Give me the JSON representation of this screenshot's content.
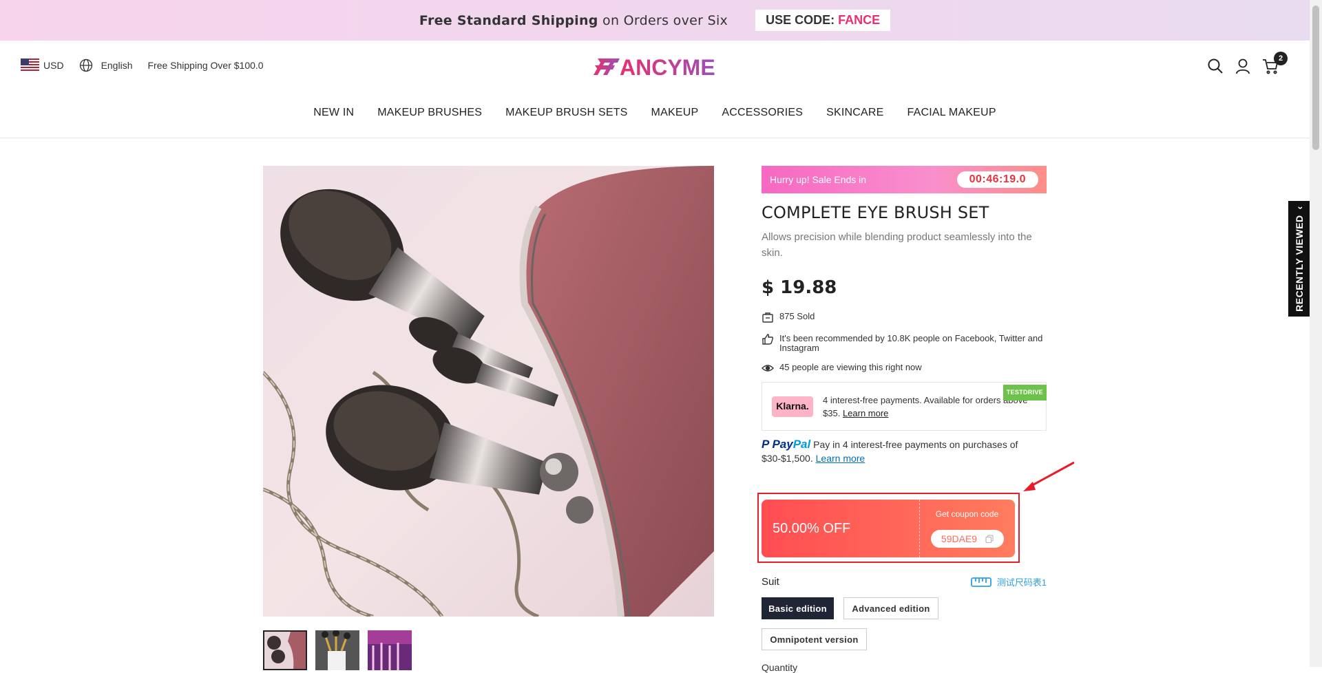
{
  "announcement": {
    "bold": "Free Standard Shipping",
    "rest": " on Orders over Six",
    "code_label": "USE CODE: ",
    "code": "FANCE"
  },
  "header": {
    "currency": "USD",
    "language": "English",
    "shipping_note": "Free Shipping Over $100.0",
    "logo_text": "ANCYME",
    "cart_count": "2"
  },
  "nav": [
    "NEW IN",
    "MAKEUP BRUSHES",
    "MAKEUP BRUSH SETS",
    "MAKEUP",
    "ACCESSORIES",
    "SKINCARE",
    "FACIAL MAKEUP"
  ],
  "recently_viewed": "RECENTLY VIEWED",
  "product": {
    "sale_label": "Hurry up! Sale Ends in",
    "timer": "00:46:19.0",
    "title": "COMPLETE EYE BRUSH SET",
    "description": "Allows precision while blending product seamlessly into the skin.",
    "price": "$ 19.88",
    "sold": "875 Sold",
    "recommended": "It's been recommended by 10.8K people on Facebook, Twitter and Instagram",
    "viewing": "45 people are viewing this right now"
  },
  "klarna": {
    "logo": "Klarna.",
    "text": "4 interest-free payments. Available for orders above $35.",
    "link": "Learn more",
    "tag": "TESTDRIVE"
  },
  "paypal": {
    "logo_a": "Pay",
    "logo_b": "Pal",
    "text": "Pay in 4 interest-free payments on purchases of $30-$1,500.",
    "link": "Learn more"
  },
  "coupon": {
    "discount": "50.00% OFF",
    "label": "Get coupon code",
    "code": "59DAE9"
  },
  "variants": {
    "label": "Suit",
    "size_chart": "测试尺码表1",
    "options": [
      "Basic edition",
      "Advanced edition",
      "Omnipotent version"
    ],
    "selected": "Basic edition"
  },
  "quantity_label": "Quantity"
}
